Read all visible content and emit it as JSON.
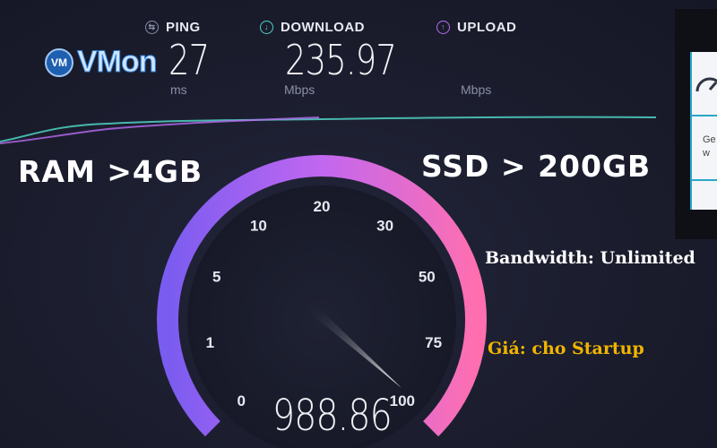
{
  "metrics": {
    "ping": {
      "label": "PING",
      "value": "27",
      "unit": "ms",
      "icon": "ping-icon",
      "color": "#8a8ea6"
    },
    "download": {
      "label": "DOWNLOAD",
      "value": "235.97",
      "unit": "Mbps",
      "icon": "download-arrow-icon",
      "color": "#4fd3c4"
    },
    "upload": {
      "label": "UPLOAD",
      "value": "",
      "unit": "Mbps",
      "icon": "upload-arrow-icon",
      "color": "#b86cf0"
    }
  },
  "logo": {
    "badge": "VM",
    "text": "VMon",
    "color": "#2d7fd6"
  },
  "overlay": {
    "ram": "RAM >4GB",
    "ssd": "SSD > 200GB",
    "bandwidth": "Bandwidth: Unlimited",
    "price": "Giá: cho Startup",
    "price_color": "#f2b400"
  },
  "gauge": {
    "scale": [
      "0",
      "1",
      "5",
      "10",
      "20",
      "30",
      "50",
      "75",
      "100"
    ],
    "reading": "988.86",
    "needle_position": "100",
    "arc_colors": [
      "#7a5cf0",
      "#c167f0",
      "#ff6fb0"
    ]
  },
  "side_card": {
    "text_1": "Ge",
    "text_2": "w",
    "icon": "speedometer-icon"
  },
  "colors": {
    "background": "#1b1d2e",
    "download_line": "#4fd3c4",
    "upload_line": "#b86cf0"
  }
}
